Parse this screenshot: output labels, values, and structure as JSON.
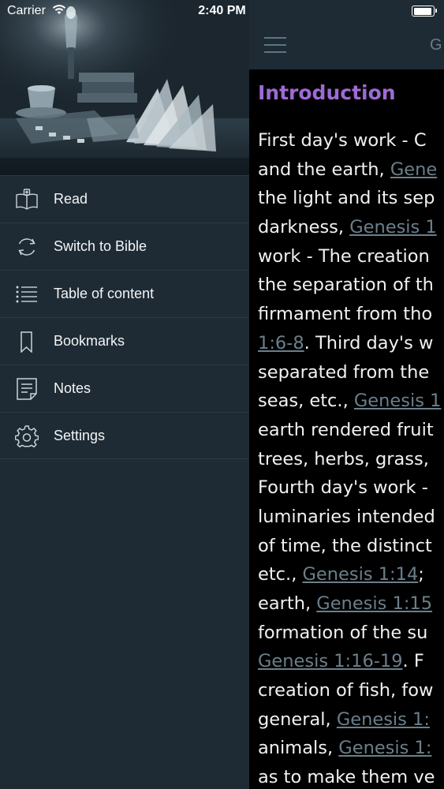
{
  "status_bar": {
    "carrier": "Carrier",
    "time": "2:40 PM",
    "battery": 1.0
  },
  "side_menu": {
    "items": [
      {
        "label": "Read",
        "icon": "open-book-icon"
      },
      {
        "label": "Switch to Bible",
        "icon": "sync-icon"
      },
      {
        "label": "Table of content",
        "icon": "list-icon"
      },
      {
        "label": "Bookmarks",
        "icon": "bookmark-icon"
      },
      {
        "label": "Notes",
        "icon": "notes-icon"
      },
      {
        "label": "Settings",
        "icon": "gear-icon"
      }
    ]
  },
  "nav": {
    "title": "G"
  },
  "content": {
    "heading": "Introduction",
    "lines": [
      [
        {
          "t": "First day's work - C"
        }
      ],
      [
        {
          "t": "and the earth, "
        },
        {
          "t": "Gene",
          "link": true
        }
      ],
      [
        {
          "t": "the light and its sep"
        }
      ],
      [
        {
          "t": "darkness, "
        },
        {
          "t": "Genesis 1",
          "link": true
        }
      ],
      [
        {
          "t": "work - The creation"
        }
      ],
      [
        {
          "t": "the separation of th"
        }
      ],
      [
        {
          "t": "firmament from tho"
        }
      ],
      [
        {
          "t": "1:6-8",
          "link": true
        },
        {
          "t": ". Third day's w"
        }
      ],
      [
        {
          "t": "separated from the"
        }
      ],
      [
        {
          "t": "seas, etc., "
        },
        {
          "t": "Genesis 1",
          "link": true
        }
      ],
      [
        {
          "t": "earth rendered fruit"
        }
      ],
      [
        {
          "t": "trees, herbs, grass,"
        }
      ],
      [
        {
          "t": "Fourth day's work -"
        }
      ],
      [
        {
          "t": "luminaries intended"
        }
      ],
      [
        {
          "t": "of time, the distinct"
        }
      ],
      [
        {
          "t": "etc., "
        },
        {
          "t": "Genesis 1:14",
          "link": true
        },
        {
          "t": ";"
        }
      ],
      [
        {
          "t": "earth, "
        },
        {
          "t": "Genesis 1:15",
          "link": true
        }
      ],
      [
        {
          "t": "formation of the su"
        }
      ],
      [
        {
          "t": "Genesis 1:16-19",
          "link": true
        },
        {
          "t": ". F"
        }
      ],
      [
        {
          "t": "creation of fish, fow"
        }
      ],
      [
        {
          "t": "general, "
        },
        {
          "t": "Genesis 1:",
          "link": true
        }
      ],
      [
        {
          "t": "animals, "
        },
        {
          "t": "Genesis 1:",
          "link": true
        }
      ],
      [
        {
          "t": "as to make them ve"
        }
      ]
    ]
  }
}
